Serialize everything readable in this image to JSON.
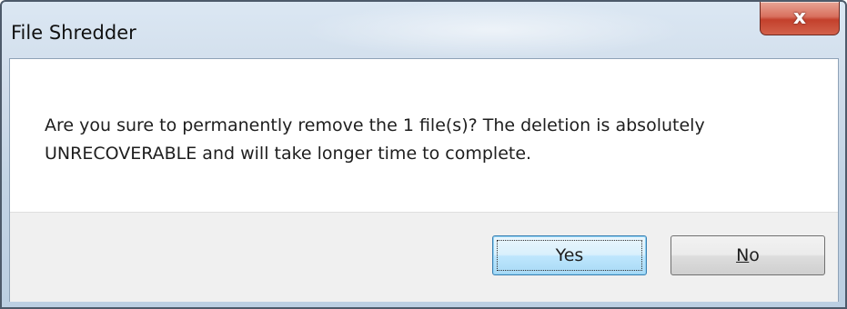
{
  "window": {
    "title": "File Shredder",
    "close_glyph": "x"
  },
  "dialog": {
    "message_line1": "Are you sure to permanently remove the 1 file(s)? The deletion is absolutely",
    "message_line2": "UNRECOVERABLE and will take longer time to complete."
  },
  "buttons": {
    "yes_label": "Yes",
    "no_accel": "N",
    "no_rest": "o"
  },
  "colors": {
    "close_button": "#c3402c",
    "default_button_border": "#3c7fb1",
    "footer_background": "#f0f0f0"
  }
}
